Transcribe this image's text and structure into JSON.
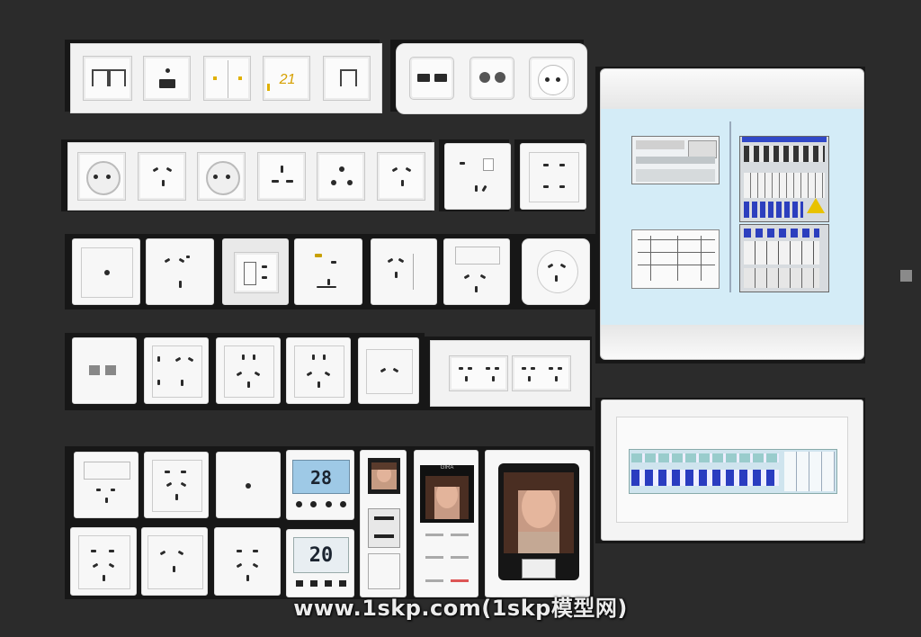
{
  "thermostat_top": {
    "temperature": "28"
  },
  "thermostat_bottom": {
    "temperature": "20"
  },
  "dimmer_display": {
    "value": "21"
  },
  "intercom": {
    "brand": "GIRA"
  },
  "watermark": {
    "text": "www.1skp.com(1skp模型网)"
  }
}
